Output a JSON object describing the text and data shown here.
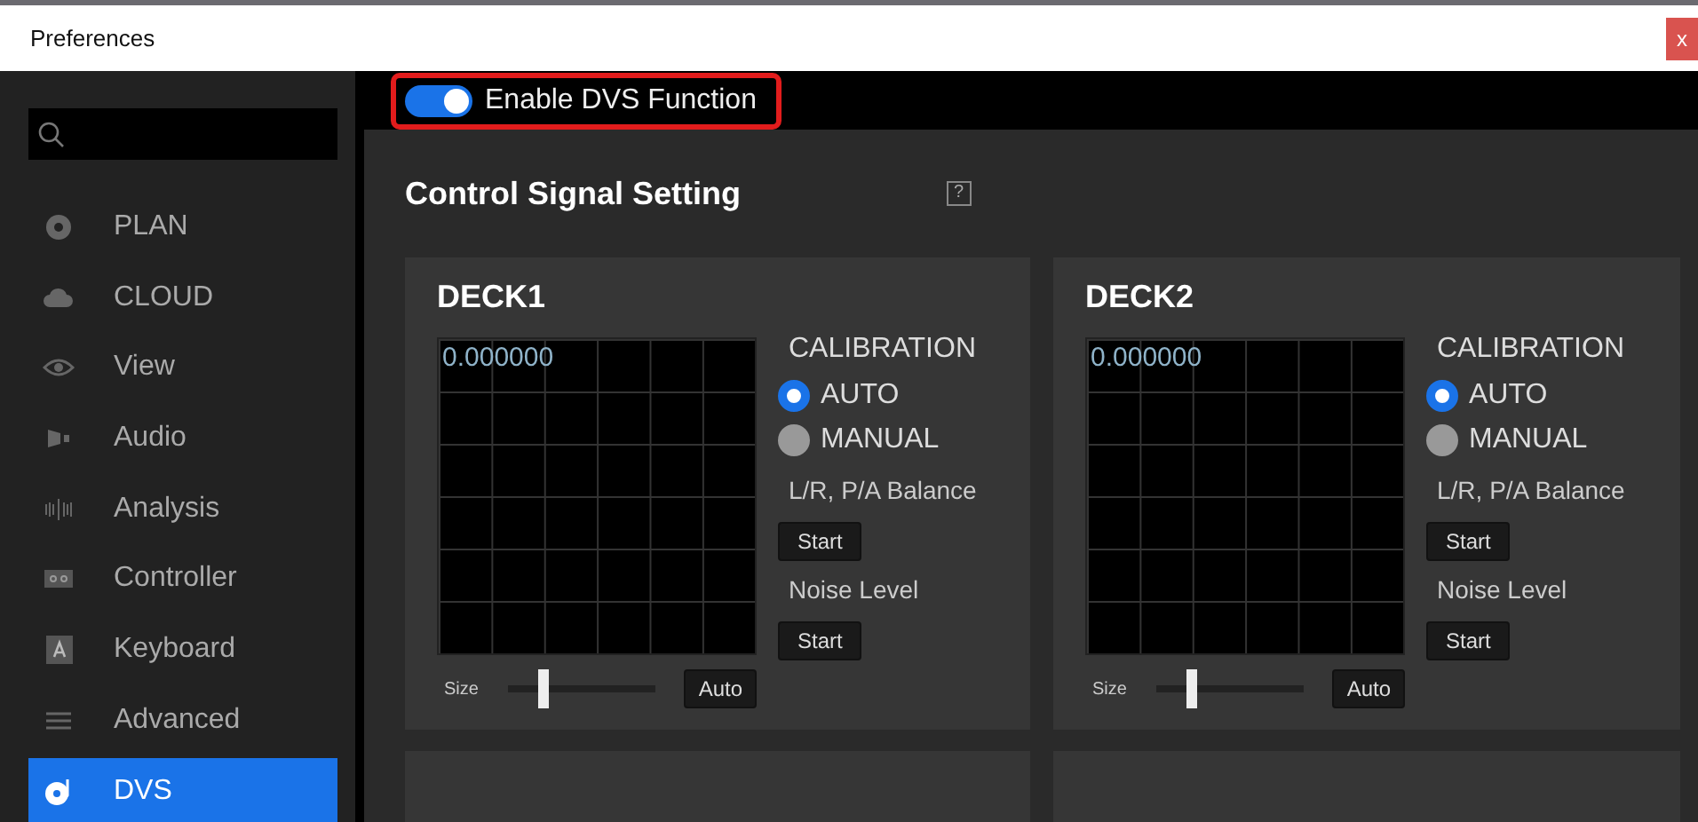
{
  "window": {
    "title": "Preferences",
    "close_label": "x"
  },
  "sidebar": {
    "items": [
      {
        "label": "PLAN",
        "selected": false
      },
      {
        "label": "CLOUD",
        "selected": false
      },
      {
        "label": "View",
        "selected": false
      },
      {
        "label": "Audio",
        "selected": false
      },
      {
        "label": "Analysis",
        "selected": false
      },
      {
        "label": "Controller",
        "selected": false
      },
      {
        "label": "Keyboard",
        "selected": false
      },
      {
        "label": "Advanced",
        "selected": false
      },
      {
        "label": "DVS",
        "selected": true
      }
    ]
  },
  "dvs_toggle": {
    "label": "Enable DVS Function",
    "on": true
  },
  "section": {
    "title": "Control Signal Setting",
    "help": "?"
  },
  "decks": [
    {
      "title": "DECK1",
      "reading": "0.000000",
      "calibration_label": "CALIBRATION",
      "options": [
        {
          "label": "AUTO",
          "selected": true
        },
        {
          "label": "MANUAL",
          "selected": false
        }
      ],
      "balance_label": "L/R, P/A Balance",
      "balance_button": "Start",
      "noise_label": "Noise Level",
      "noise_button": "Start",
      "size_label": "Size",
      "size": {
        "level": 0.23
      },
      "auto_button": "Auto"
    },
    {
      "title": "DECK2",
      "reading": "0.000000",
      "calibration_label": "CALIBRATION",
      "options": [
        {
          "label": "AUTO",
          "selected": true
        },
        {
          "label": "MANUAL",
          "selected": false
        }
      ],
      "balance_label": "L/R, P/A Balance",
      "balance_button": "Start",
      "noise_label": "Noise Level",
      "noise_button": "Start",
      "size_label": "Size",
      "size": {
        "level": 0.23
      },
      "auto_button": "Auto"
    }
  ]
}
